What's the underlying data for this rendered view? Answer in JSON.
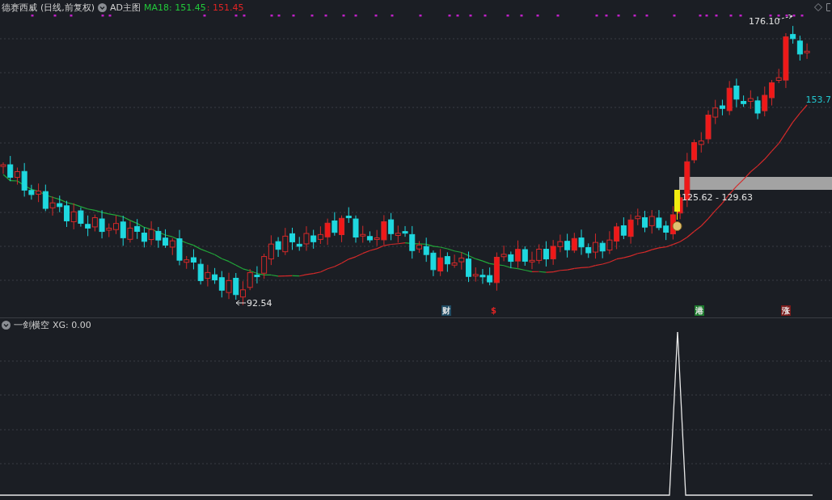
{
  "header": {
    "stock": "德赛西威",
    "period": "(日线,前复权)",
    "indicator": "AD主图",
    "ma_label": "MA18: 151.45",
    "ma_value": ": 151.45"
  },
  "price_labels": {
    "high": "176.10",
    "low": "92.54",
    "last": "153.7",
    "range": "125.62 - 129.63"
  },
  "markers": [
    {
      "text": "财",
      "kind": "badge",
      "color": "#1f4b63"
    },
    {
      "text": "$",
      "kind": "plain",
      "color": "#e02424"
    },
    {
      "text": "港",
      "kind": "badge",
      "color": "#1c7a2c"
    },
    {
      "text": "涨",
      "kind": "badge",
      "color": "#7a1a1a"
    }
  ],
  "sub_panel": {
    "name": "一剑横空",
    "reading": "XG: 0.00"
  }
}
